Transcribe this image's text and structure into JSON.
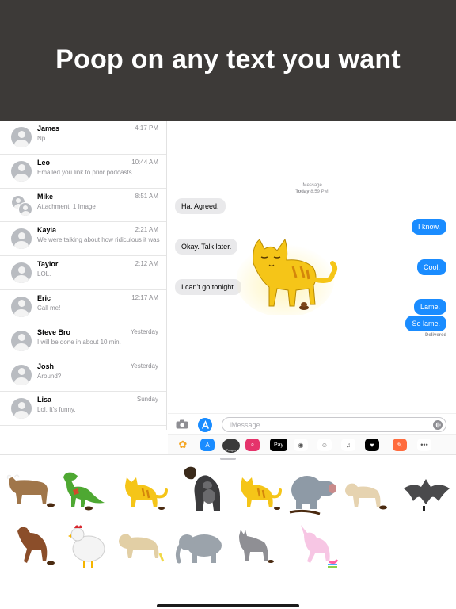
{
  "banner": {
    "headline": "Poop on any text you want"
  },
  "conversations": [
    {
      "name": "James",
      "time": "4:17 PM",
      "snippet": "Np",
      "group": false
    },
    {
      "name": "Leo",
      "time": "10:44 AM",
      "snippet": "Emailed you link to prior podcasts",
      "group": false
    },
    {
      "name": "Mike",
      "time": "8:51 AM",
      "snippet": "Attachment: 1 Image",
      "group": true
    },
    {
      "name": "Kayla",
      "time": "2:21 AM",
      "snippet": "We were talking about how ridiculous it was",
      "group": false
    },
    {
      "name": "Taylor",
      "time": "2:12 AM",
      "snippet": "LOL.",
      "group": false
    },
    {
      "name": "Eric",
      "time": "12:17 AM",
      "snippet": "Call me!",
      "group": false
    },
    {
      "name": "Steve Bro",
      "time": "Yesterday",
      "snippet": "I will be done in about 10 min.",
      "group": false
    },
    {
      "name": "Josh",
      "time": "Yesterday",
      "snippet": "Around?",
      "group": false
    },
    {
      "name": "Lisa",
      "time": "Sunday",
      "snippet": "Lol. It's funny.",
      "group": false
    }
  ],
  "thread": {
    "service": "iMessage",
    "timestamp_day": "Today",
    "timestamp_time": "8:59 PM",
    "messages": [
      {
        "dir": "in",
        "text": "Ha. Agreed."
      },
      {
        "dir": "out",
        "text": "I know."
      },
      {
        "dir": "in",
        "text": "Okay. Talk later."
      },
      {
        "dir": "out",
        "text": "Cool."
      },
      {
        "dir": "in",
        "text": "I can't go tonight."
      },
      {
        "dir": "out",
        "text": "Lame."
      },
      {
        "dir": "out",
        "text": "So lame."
      }
    ],
    "status": "Delivered"
  },
  "input": {
    "placeholder": "iMessage"
  },
  "tray": {
    "apps": [
      {
        "icon": "photos-icon",
        "color": "#f5a623"
      },
      {
        "icon": "app-store-icon",
        "color": "#1a8cff"
      },
      {
        "icon": "pooper-app-icon",
        "color": "#3a3a3a",
        "label": "Pooper"
      },
      {
        "icon": "search-images-icon",
        "color": "#e5336b"
      },
      {
        "icon": "apple-pay-icon",
        "color": "#000000"
      },
      {
        "icon": "animoji-monkey-icon",
        "color": "#ffffff"
      },
      {
        "icon": "memoji-icon",
        "color": "#ffffff"
      },
      {
        "icon": "music-icon",
        "color": "#ffffff"
      },
      {
        "icon": "digital-touch-icon",
        "color": "#000000"
      },
      {
        "icon": "sticker-app-icon",
        "color": "#ff6b3d"
      },
      {
        "icon": "more-icon",
        "color": "#ffffff"
      }
    ]
  },
  "stickers": [
    "bull-sticker",
    "t-rex-sticker",
    "cat-sticker",
    "gorilla-sticker",
    "cat-sticker-2",
    "hippo-sticker",
    "dog-sticker",
    "bat-sticker",
    "horse-sticker",
    "chicken-sticker",
    "labrador-sticker",
    "elephant-sticker",
    "donkey-sticker",
    "unicorn-sticker"
  ]
}
